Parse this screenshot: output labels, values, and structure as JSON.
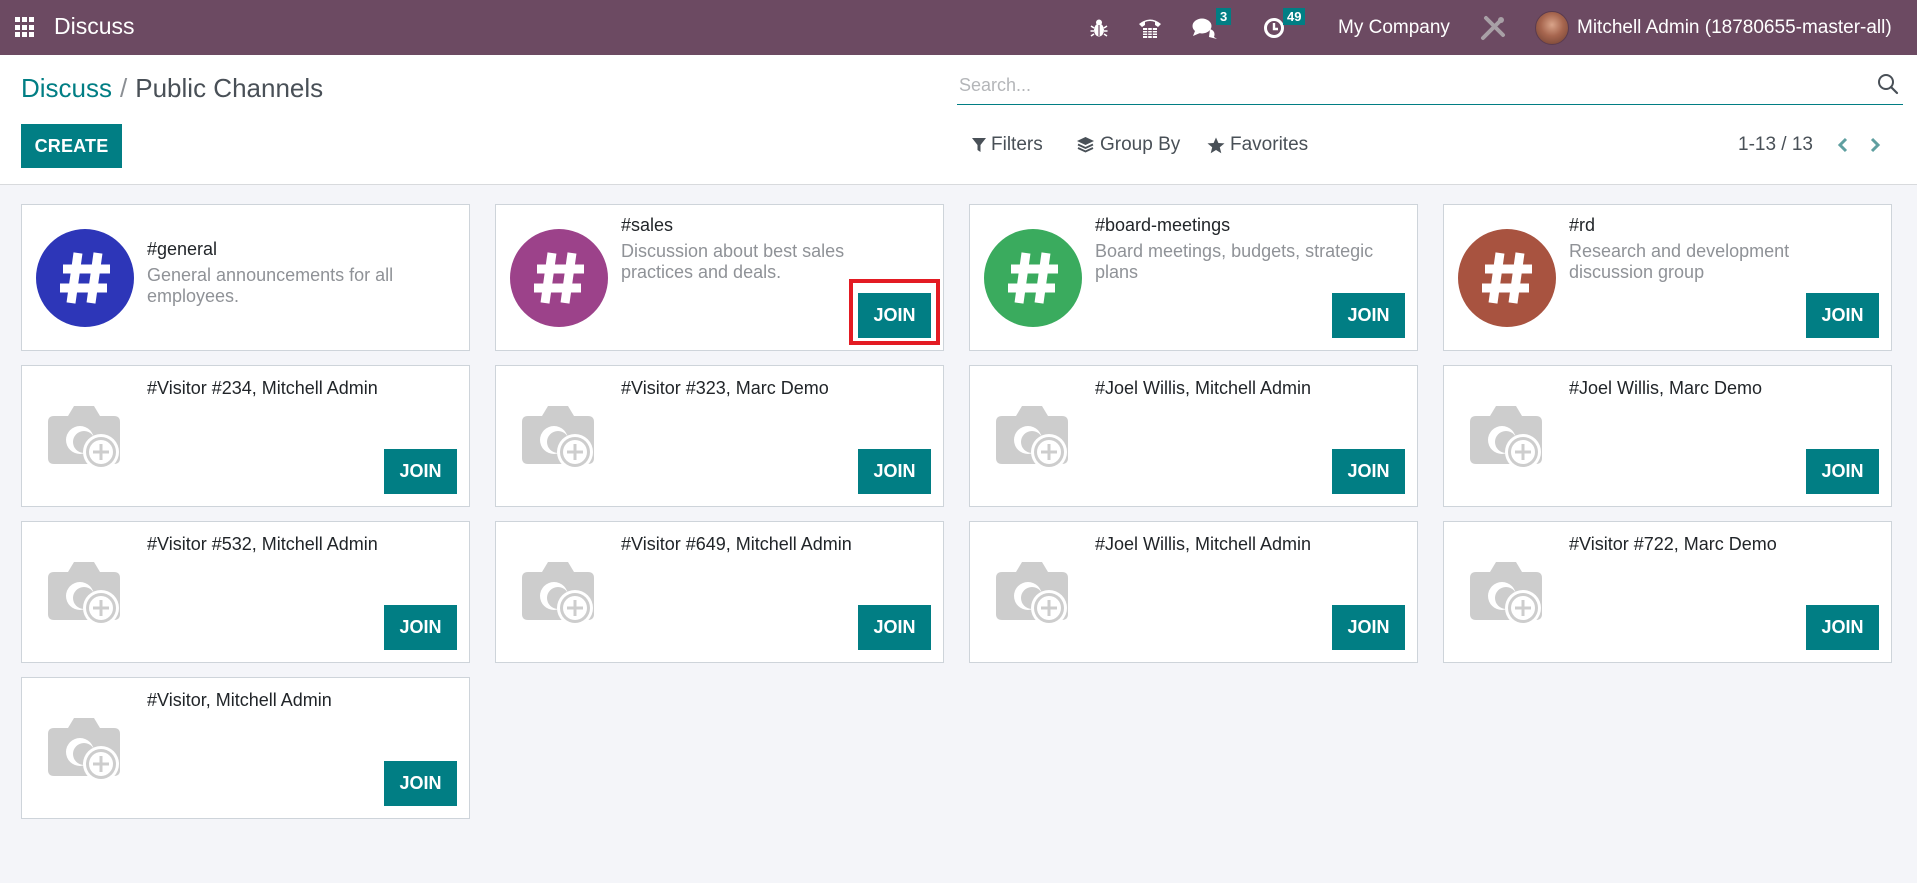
{
  "navbar": {
    "app_name": "Discuss",
    "messages_badge": "3",
    "activities_badge": "49",
    "company": "My Company",
    "user_name": "Mitchell Admin (18780655-master-all)",
    "icons": [
      "apps-grid-icon",
      "bug-icon",
      "phone-icon",
      "comments-icon",
      "clock-icon",
      "tools-icon"
    ]
  },
  "control_panel": {
    "breadcrumb": {
      "parent": "Discuss",
      "separator": "/",
      "current": "Public Channels"
    },
    "create_label": "CREATE",
    "search": {
      "placeholder": "Search...",
      "value": ""
    },
    "filters_label": "Filters",
    "group_by_label": "Group By",
    "favorites_label": "Favorites",
    "pager": {
      "value": "1-13 / 13"
    }
  },
  "colors": {
    "navbar": "#6c4a62",
    "primary": "#017e84",
    "highlight": "#e31b23",
    "general": "#2d36b8",
    "sales": "#9c428a",
    "board_meetings": "#3aab5e",
    "rd": "#a85340"
  },
  "channels": [
    {
      "name": "#general",
      "description": "General announcements for all employees.",
      "logo": "hash",
      "color": "#2d36b8",
      "join": false
    },
    {
      "name": "#sales",
      "description": "Discussion about best sales practices and deals.",
      "logo": "hash",
      "color": "#9c428a",
      "join": true,
      "highlighted": true
    },
    {
      "name": "#board-meetings",
      "description": "Board meetings, budgets, strategic plans",
      "logo": "hash",
      "color": "#3aab5e",
      "join": true
    },
    {
      "name": "#rd",
      "description": "Research and development discussion group",
      "logo": "hash",
      "color": "#a85340",
      "join": true
    },
    {
      "name": "#Visitor #234, Mitchell Admin",
      "logo": "camera",
      "join": true
    },
    {
      "name": "#Visitor #323, Marc Demo",
      "logo": "camera",
      "join": true
    },
    {
      "name": "#Joel Willis, Mitchell Admin",
      "logo": "camera",
      "join": true
    },
    {
      "name": "#Joel Willis, Marc Demo",
      "logo": "camera",
      "join": true
    },
    {
      "name": "#Visitor #532, Mitchell Admin",
      "logo": "camera",
      "join": true
    },
    {
      "name": "#Visitor #649, Mitchell Admin",
      "logo": "camera",
      "join": true
    },
    {
      "name": "#Joel Willis, Mitchell Admin",
      "logo": "camera",
      "join": true
    },
    {
      "name": "#Visitor #722, Marc Demo",
      "logo": "camera",
      "join": true
    },
    {
      "name": "#Visitor, Mitchell Admin",
      "logo": "camera",
      "join": true
    }
  ],
  "join_label": "JOIN"
}
